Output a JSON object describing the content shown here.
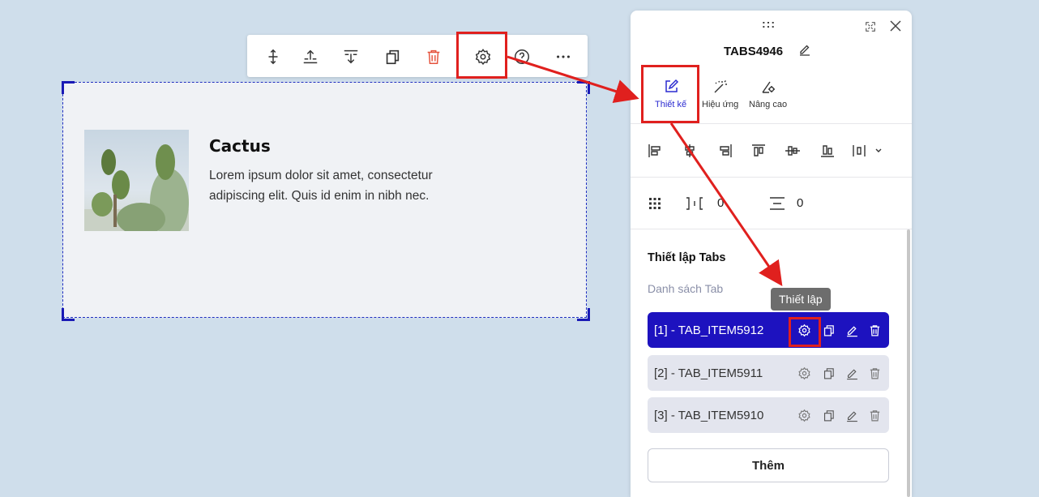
{
  "toolbar": {
    "items": [
      {
        "name": "move",
        "icon": "move-vertical-icon"
      },
      {
        "name": "insert-above",
        "icon": "insert-above-icon"
      },
      {
        "name": "insert-below",
        "icon": "insert-below-icon"
      },
      {
        "name": "duplicate",
        "icon": "copy-icon"
      },
      {
        "name": "delete",
        "icon": "trash-icon"
      },
      {
        "name": "settings",
        "icon": "gear-icon"
      },
      {
        "name": "help",
        "icon": "help-icon"
      },
      {
        "name": "more",
        "icon": "more-horizontal-icon"
      }
    ]
  },
  "canvas": {
    "title": "Cactus",
    "description": "Lorem ipsum dolor sit amet, consectetur adipiscing elit. Quis id enim in nibh nec.",
    "image_icon": "cactus-image"
  },
  "panel": {
    "drag_handle": ":::",
    "title": "TABS4946",
    "mode_tabs": [
      {
        "label": "Thiết kế",
        "icon": "edit-icon",
        "active": true
      },
      {
        "label": "Hiệu ứng",
        "icon": "magic-wand-icon",
        "active": false
      },
      {
        "label": "Nâng cao",
        "icon": "advanced-settings-icon",
        "active": false
      }
    ],
    "spacing": {
      "gap_value": "0",
      "line_value": "0"
    },
    "section_title": "Thiết lập Tabs",
    "section_sub": "Danh sách Tab",
    "tooltip": "Thiết lập",
    "tabs": [
      {
        "label": "[1] - TAB_ITEM5912",
        "active": true
      },
      {
        "label": "[2] - TAB_ITEM5911",
        "active": false
      },
      {
        "label": "[3] - TAB_ITEM5910",
        "active": false
      }
    ],
    "add_label": "Thêm"
  },
  "colors": {
    "background": "#cfdeeb",
    "accent": "#1d12bf",
    "highlight": "#e0201e",
    "delete": "#e5533d"
  }
}
